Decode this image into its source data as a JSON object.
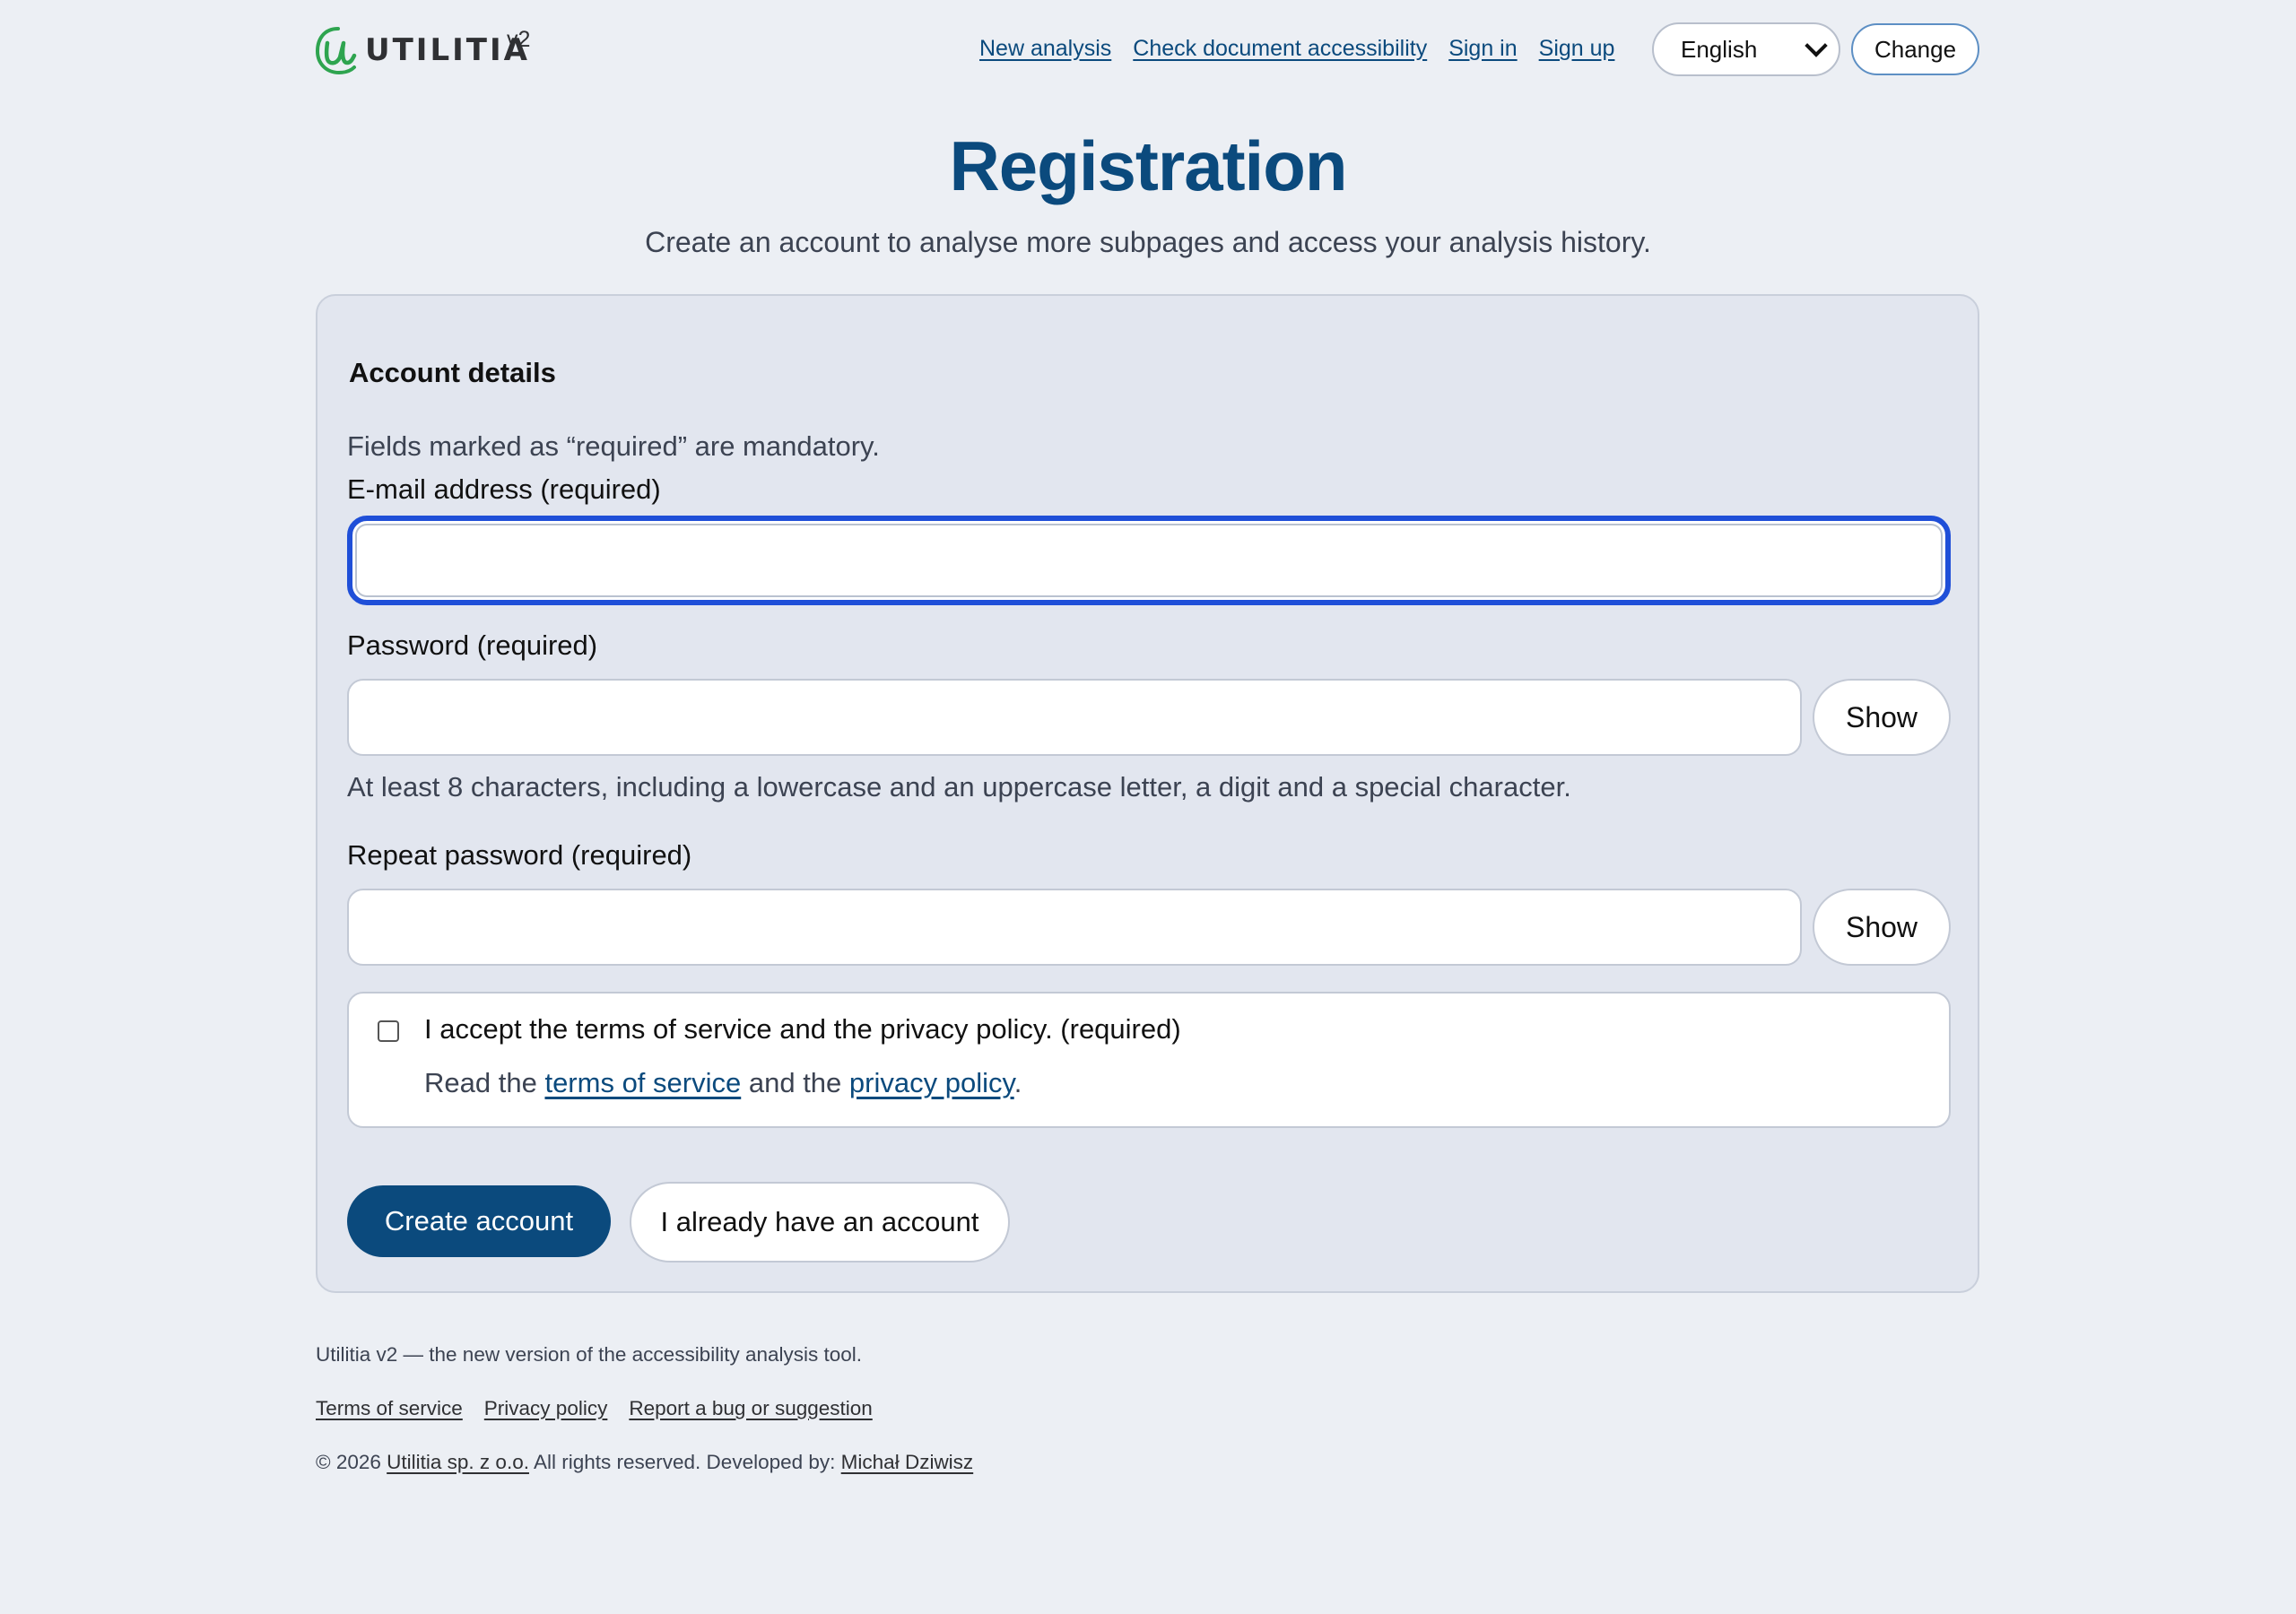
{
  "header": {
    "logo_text": "UTILITIA",
    "version": "v2",
    "nav": [
      {
        "label": "New analysis"
      },
      {
        "label": "Check document accessibility"
      },
      {
        "label": "Sign in"
      },
      {
        "label": "Sign up"
      }
    ],
    "language": {
      "selected": "English"
    },
    "change_label": "Change"
  },
  "page": {
    "title": "Registration",
    "subtitle": "Create an account to analyse more subpages and access your analysis history."
  },
  "form": {
    "section_title": "Account details",
    "required_note": "Fields marked as “required” are mandatory.",
    "email": {
      "label": "E-mail address (required)",
      "value": ""
    },
    "password": {
      "label": "Password (required)",
      "value": "",
      "show_label": "Show",
      "hint": "At least 8 characters, including a lowercase and an uppercase letter, a digit and a special character."
    },
    "repeat_password": {
      "label": "Repeat password (required)",
      "value": "",
      "show_label": "Show"
    },
    "terms": {
      "checked": false,
      "label": "I accept the terms of service and the privacy policy. (required)",
      "read_prefix": "Read the",
      "tos_link": "terms of service",
      "and_text": "and the",
      "privacy_link": "privacy policy",
      "suffix": "."
    },
    "create_label": "Create account",
    "have_account_label": "I already have an account"
  },
  "footer": {
    "tagline": "Utilitia v2 — the new version of the accessibility analysis tool.",
    "links": [
      {
        "label": "Terms of service"
      },
      {
        "label": "Privacy policy"
      },
      {
        "label": "Report a bug or suggestion"
      }
    ],
    "copyright_prefix": "© 2026",
    "company_link": "Utilitia sp. z o.o.",
    "rights_text": "All rights reserved. Developed by:",
    "developer_link": "Michał Dziwisz"
  },
  "colors": {
    "brand_blue": "#0b4a7d",
    "logo_green": "#2ea44f",
    "focus_ring": "#1f4fd8",
    "page_bg": "#eceff4",
    "card_bg": "#e2e6ef"
  },
  "icons": [
    "utilitia-logo-icon",
    "chevron-down-icon"
  ]
}
